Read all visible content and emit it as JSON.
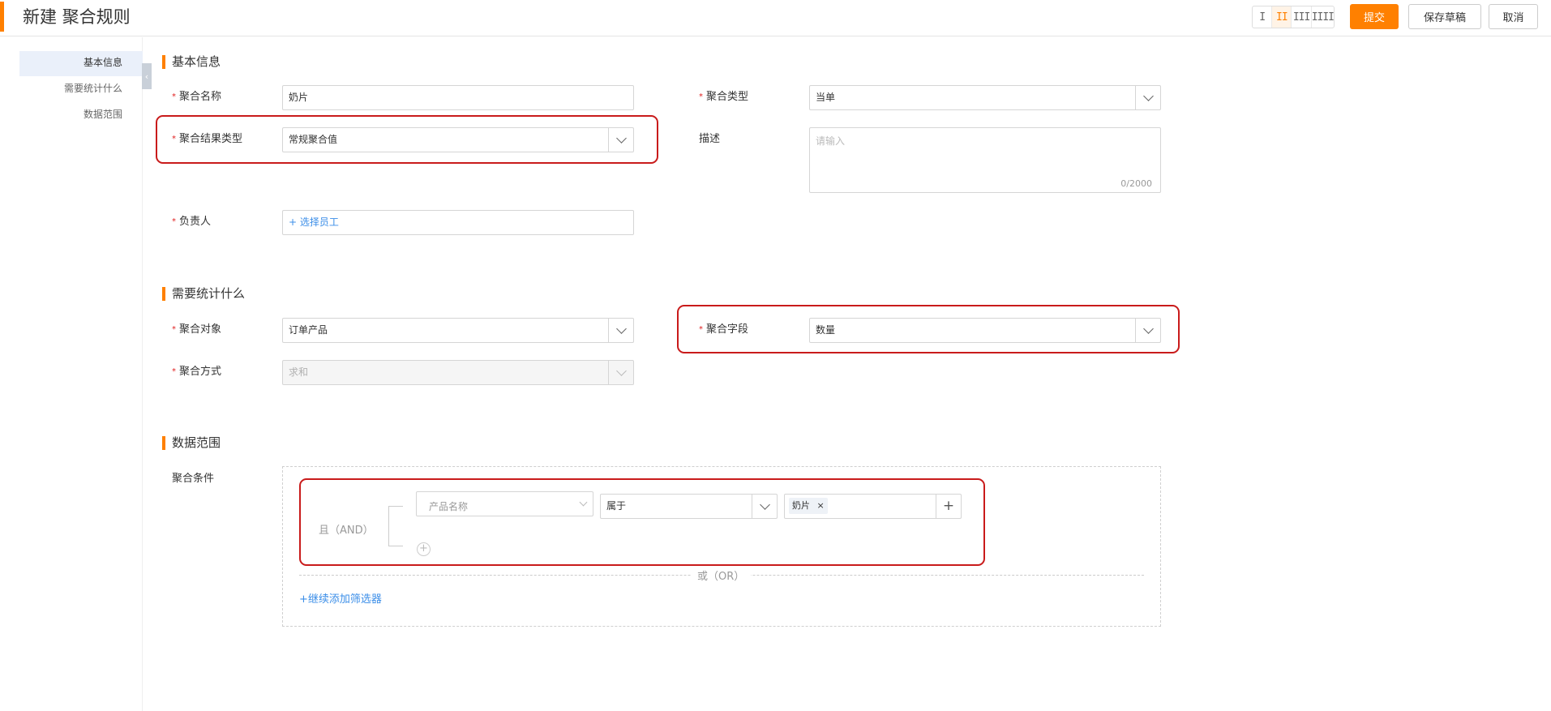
{
  "header": {
    "title": "新建 聚合规则",
    "column_switch": [
      "I",
      "II",
      "III",
      "IIII"
    ],
    "submit_label": "提交",
    "draft_label": "保存草稿",
    "cancel_label": "取消",
    "accent_color": "#ff8000"
  },
  "sidebar": {
    "items": [
      {
        "label": "基本信息",
        "active": true
      },
      {
        "label": "需要统计什么",
        "active": false
      },
      {
        "label": "数据范围",
        "active": false
      }
    ],
    "collapse_icon": "chevron-left-icon"
  },
  "basic_info": {
    "title": "基本信息",
    "name_label": "聚合名称",
    "name_value": "奶片",
    "agg_type_label": "聚合类型",
    "agg_type_value": "当单",
    "result_type_label": "聚合结果类型",
    "result_type_value": "常规聚合值",
    "desc_label": "描述",
    "desc_placeholder": "请输入",
    "desc_counter": "0/2000",
    "owner_label": "负责人",
    "owner_action": "+ 选择员工"
  },
  "stats": {
    "title": "需要统计什么",
    "object_label": "聚合对象",
    "object_value": "订单产品",
    "field_label": "聚合字段",
    "field_value": "数量",
    "method_label": "聚合方式",
    "method_value": "求和"
  },
  "scope": {
    "title": "数据范围",
    "cond_label": "聚合条件",
    "and_label": "且（AND）",
    "field_placeholder": "产品名称",
    "operator_value": "属于",
    "tag_value": "奶片",
    "tag_close": "×",
    "add_value": "+",
    "add_condition": "+",
    "or_label": "或（OR）",
    "add_filter": "+继续添加筛选器"
  }
}
